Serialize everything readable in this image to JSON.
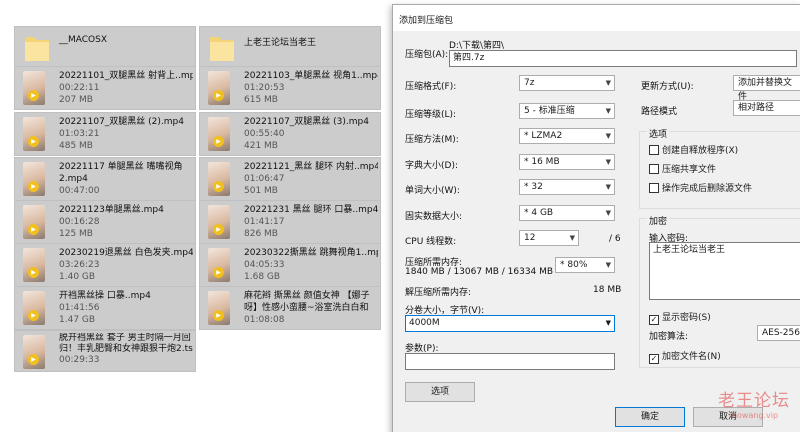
{
  "explorer": {
    "folders": [
      {
        "name": "__MACOSX"
      },
      {
        "name": "上老王论坛当老王"
      }
    ],
    "files": [
      {
        "name": "20221101_双腿黑丝 射背上..mp4",
        "duration": "00:22:11",
        "size": "207 MB"
      },
      {
        "name": "20221103_单腿黑丝 视角1..mp4",
        "duration": "01:20:53",
        "size": "615 MB"
      },
      {
        "name": "20221107_双腿黑丝 (2).mp4",
        "duration": "01:03:21",
        "size": "485 MB"
      },
      {
        "name": "20221107_双腿黑丝 (3).mp4",
        "duration": "00:55:40",
        "size": "421 MB"
      },
      {
        "name": "20221117 单腿黑丝 嘴嘴视角2.mp4",
        "duration": "00:47:00",
        "size": ""
      },
      {
        "name": "20221121_黑丝 腿环 内射..mp4",
        "duration": "01:06:47",
        "size": "501 MB"
      },
      {
        "name": "20221123单腿黑丝.mp4",
        "duration": "00:16:28",
        "size": "125 MB"
      },
      {
        "name": "20221231 黑丝 腿环 口暴..mp4",
        "duration": "01:41:17",
        "size": "826 MB"
      },
      {
        "name": "20230219退黑丝 白色发夹.mp4",
        "duration": "03:26:23",
        "size": "1.40 GB"
      },
      {
        "name": "20230322撕黑丝 跳舞视角1..mp4",
        "duration": "04:05:33",
        "size": "1.68 GB"
      },
      {
        "name": "开裆黑丝操 口暴..mp4",
        "duration": "01:41:56",
        "size": "1.47 GB"
      },
      {
        "name": "麻花辫 撕黑丝 颜值女神 【娜子呀】性感小蛮腰~浴室洗白白和炮...",
        "duration": "01:08:08",
        "size": ""
      },
      {
        "name": "脱开裆黑丝 套子 男主时隔一月回归！丰乳肥臀和女神跟狠干炮2.ts",
        "duration": "00:29:33",
        "size": ""
      }
    ]
  },
  "dialog": {
    "title": "添加到压缩包",
    "archive_label": "压缩包(A):",
    "archive_path": "D:\\下载\\第四\\",
    "archive_name": "第四.7z",
    "format_label": "压缩格式(F):",
    "format_value": "7z",
    "level_label": "压缩等级(L):",
    "level_value": "5 - 标准压缩",
    "method_label": "压缩方法(M):",
    "method_value": "* LZMA2",
    "dict_label": "字典大小(D):",
    "dict_value": "* 16 MB",
    "word_label": "单词大小(W):",
    "word_value": "* 32",
    "solid_label": "固实数据大小:",
    "solid_value": "* 4 GB",
    "threads_label": "CPU 线程数:",
    "threads_value": "12",
    "threads_total": "/ 6",
    "mem_label": "压缩所需内存:",
    "mem_value": "1840 MB / 13067 MB / 16334 MB",
    "mem_percent": "* 80%",
    "decomp_label": "解压缩所需内存:",
    "decomp_value": "18 MB",
    "split_label": "分卷大小，字节(V):",
    "split_value": "4000M",
    "params_label": "参数(P):",
    "params_value": "",
    "options_button": "选项",
    "update_label": "更新方式(U):",
    "update_value": "添加并替换文件",
    "path_label": "路径模式",
    "path_value": "相对路径",
    "options_group": "选项",
    "opt_sfx": "创建自释放程序(X)",
    "opt_shared": "压缩共享文件",
    "opt_delete": "操作完成后删除源文件",
    "encrypt_group": "加密",
    "password_label": "输入密码:",
    "password_value": "上老王论坛当老王",
    "show_password": "显示密码(S)",
    "enc_method_label": "加密算法:",
    "enc_method_value": "AES-256",
    "encrypt_names": "加密文件名(N)",
    "ok_button": "确定",
    "cancel_button": "取消"
  },
  "watermark": {
    "text": "老王论坛",
    "sub": "laowang.vip"
  }
}
